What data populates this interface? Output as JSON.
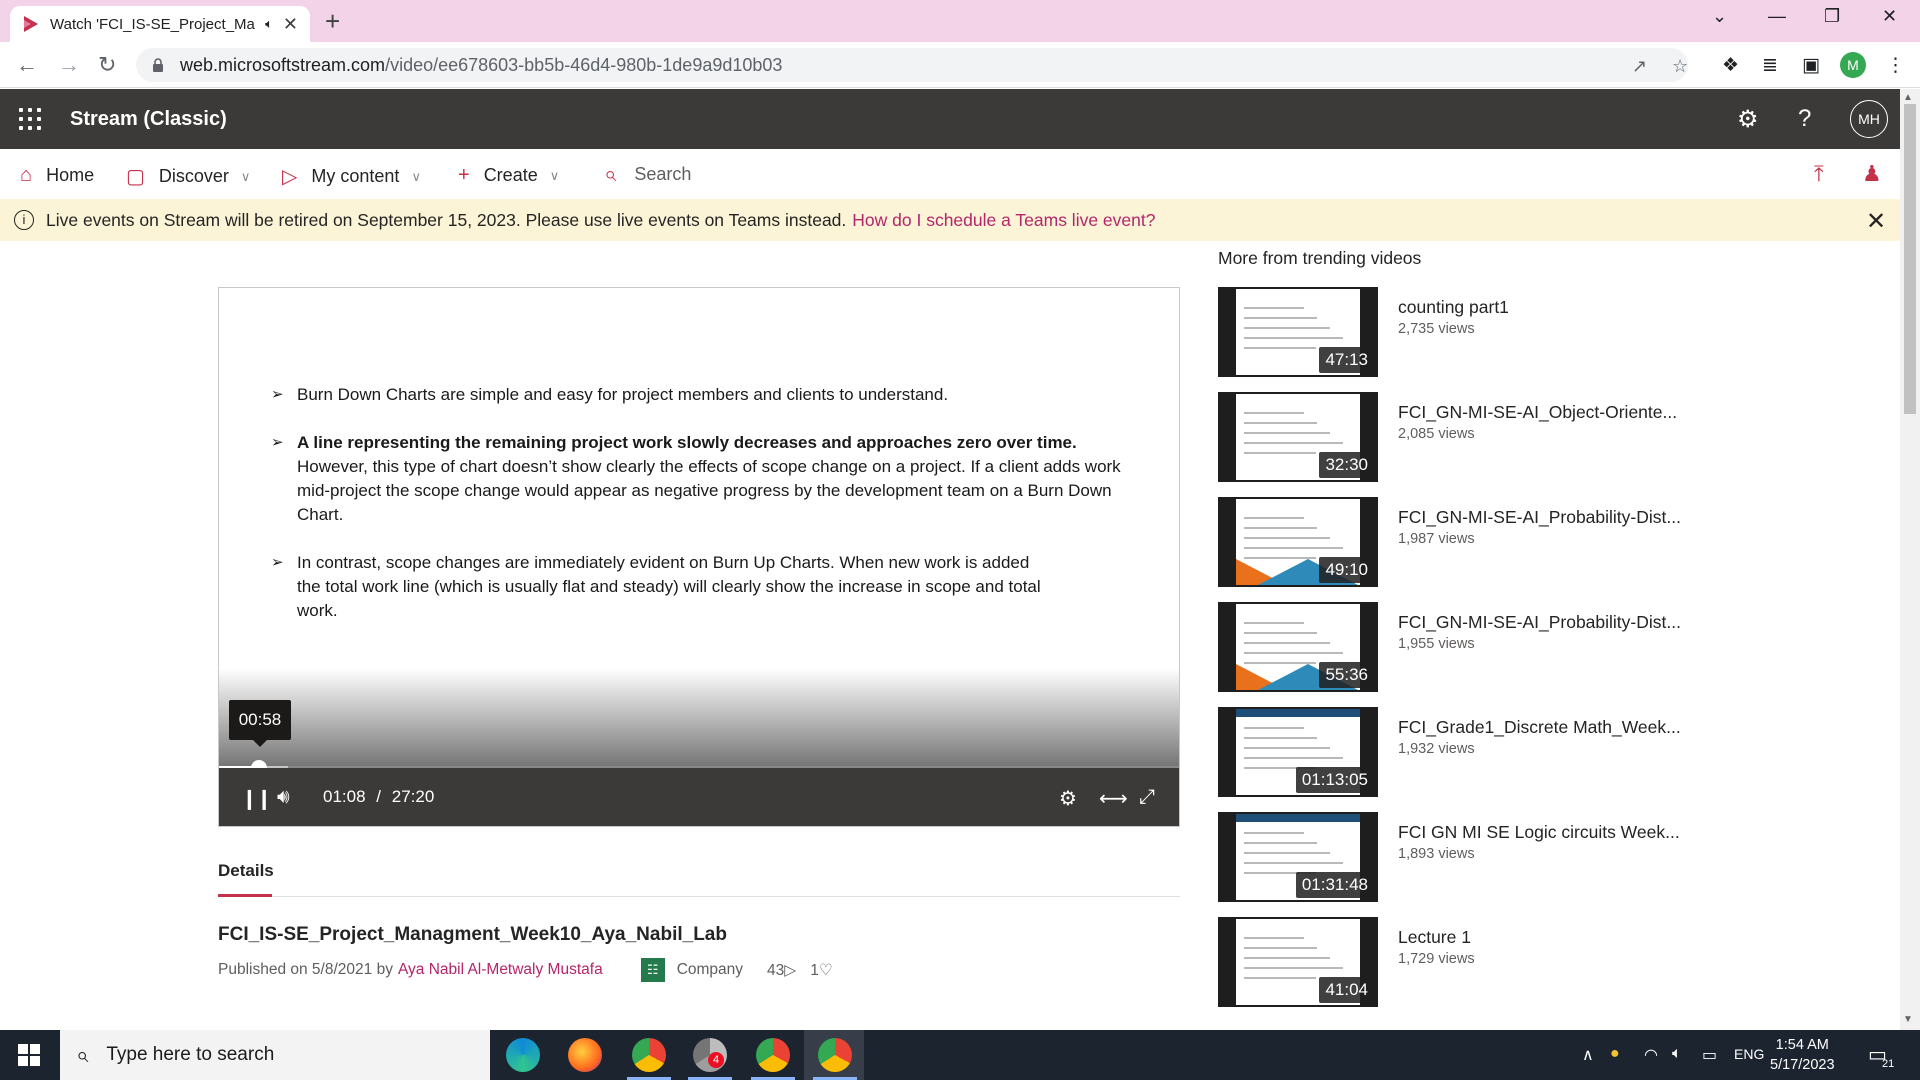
{
  "browser": {
    "tab_title": "Watch 'FCI_IS-SE_Project_Ma",
    "url_host": "web.microsoftstream.com",
    "url_path": "/video/ee678603-bb5b-46d4-980b-1de9a9d10b03",
    "profile_initial": "M"
  },
  "app": {
    "title": "Stream (Classic)",
    "avatar_initials": "MH"
  },
  "nav": {
    "home": "Home",
    "discover": "Discover",
    "my_content": "My content",
    "create": "Create",
    "search_placeholder": "Search"
  },
  "banner": {
    "text": "Live events on Stream will be retired on September 15, 2023. Please use live events on Teams instead.",
    "link": "How do I schedule a Teams live event?"
  },
  "slide": {
    "b1": "Burn Down Charts are simple and easy for project members and clients to understand.",
    "b2_bold": "A line representing the remaining project work slowly decreases and approaches zero over time.",
    "b2_rest": " However, this type of chart doesn’t show clearly the effects of scope change on a project. If a client adds work mid-project the scope change would appear as negative progress by the development team on a Burn Down Chart.",
    "b3": "In contrast, scope changes are immediately evident on Burn Up Charts.  When new work is added the total work line (which is usually flat and steady) will clearly show the increase in scope and total work."
  },
  "player": {
    "hover_time": "00:58",
    "current_time": "01:08",
    "separator": "/",
    "total_time": "27:20",
    "progress_fraction": 0.0415
  },
  "details": {
    "tab_label": "Details",
    "video_title": "FCI_IS-SE_Project_Managment_Week10_Aya_Nabil_Lab",
    "published": "Published on 5/8/2021 by",
    "author": "Aya Nabil Al-Metwaly Mustafa",
    "audience": "Company",
    "views": "43",
    "likes": "1"
  },
  "rail": {
    "heading": "More from trending videos",
    "videos": [
      {
        "title": "counting part1",
        "views": "2,735 views",
        "duration": "47:13"
      },
      {
        "title": "FCI_GN-MI-SE-AI_Object-Oriente...",
        "views": "2,085 views",
        "duration": "32:30"
      },
      {
        "title": "FCI_GN-MI-SE-AI_Probability-Dist...",
        "views": "1,987 views",
        "duration": "49:10"
      },
      {
        "title": "FCI_GN-MI-SE-AI_Probability-Dist...",
        "views": "1,955 views",
        "duration": "55:36"
      },
      {
        "title": "FCI_Grade1_Discrete Math_Week...",
        "views": "1,932 views",
        "duration": "01:13:05"
      },
      {
        "title": "FCI GN MI SE Logic circuits Week...",
        "views": "1,893 views",
        "duration": "01:31:48"
      },
      {
        "title": "Lecture 1",
        "views": "1,729 views",
        "duration": "41:04"
      }
    ]
  },
  "taskbar": {
    "search_placeholder": "Type here to search",
    "lang": "ENG",
    "time": "1:54 AM",
    "date": "5/17/2023",
    "notif_count": "21",
    "badge_count": "4"
  },
  "colors": {
    "brand": "#c4314b",
    "link": "#b4256b",
    "header_bg": "#3b3a39",
    "banner_bg": "#fcf4d6"
  }
}
